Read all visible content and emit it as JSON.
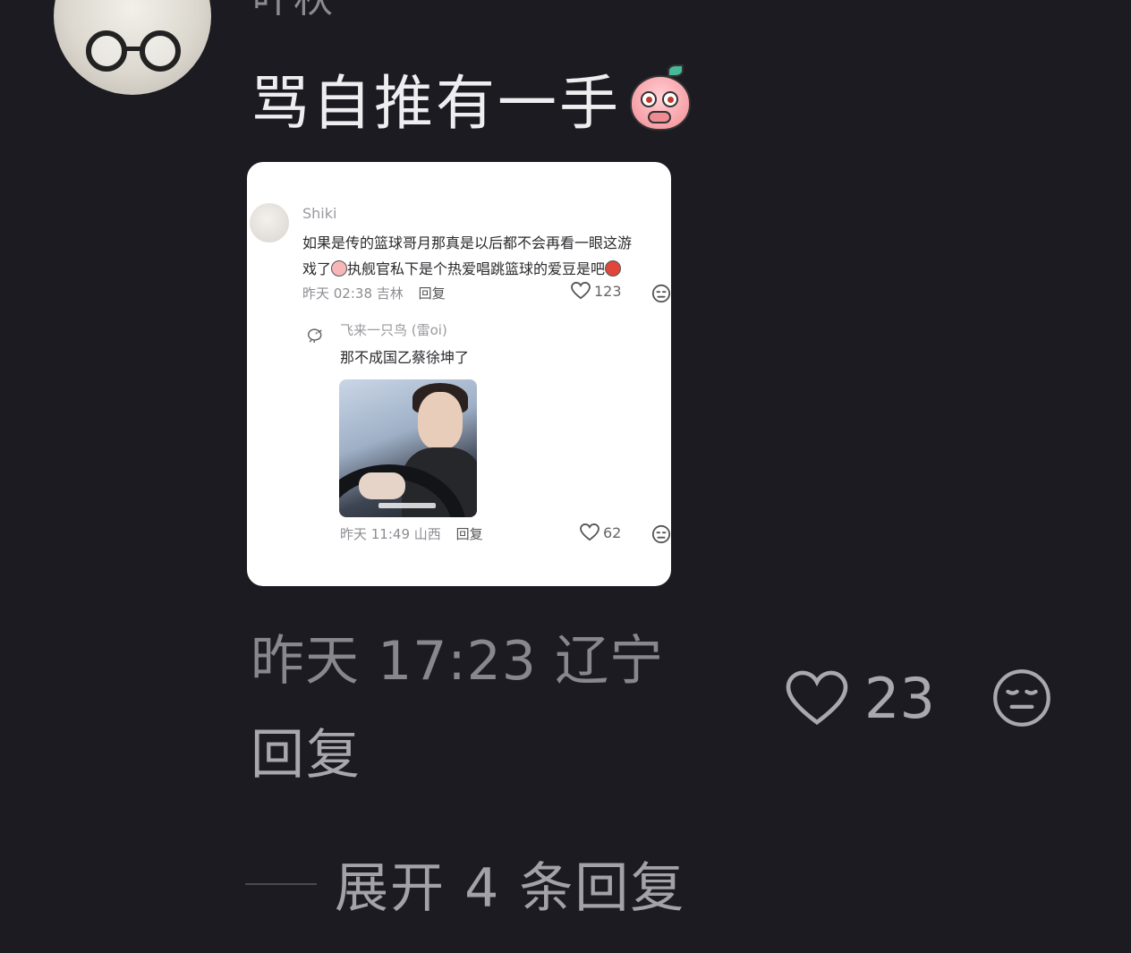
{
  "comment": {
    "username": "叶秋",
    "text": "骂自推有一手",
    "text_emoji": "peach-surprised-emoji",
    "time": "昨天 17:23",
    "location": "辽宁",
    "reply_label": "回复",
    "like_count": "23",
    "expand_label": "展开 4 条回复"
  },
  "attached_image": {
    "original": {
      "username": "Shiki",
      "text_line1": "如果是传的篮球哥月那真是以后都不会再看一眼这游",
      "text_line2_a": "戏了",
      "text_line2_b": "执舰官私下是个热爱唱跳篮球的爱豆是吧",
      "time": "昨天 02:38",
      "location": "吉林",
      "reply_label": "回复",
      "like_count": "123"
    },
    "reply": {
      "username": "飞来一只鸟 (雷oi)",
      "text": "那不成国乙蔡徐坤了",
      "time": "昨天 11:49",
      "location": "山西",
      "reply_label": "回复",
      "like_count": "62"
    }
  },
  "colors": {
    "background": "#1c1b22",
    "primary_text": "#eeeef0",
    "secondary_text": "#88878d"
  }
}
